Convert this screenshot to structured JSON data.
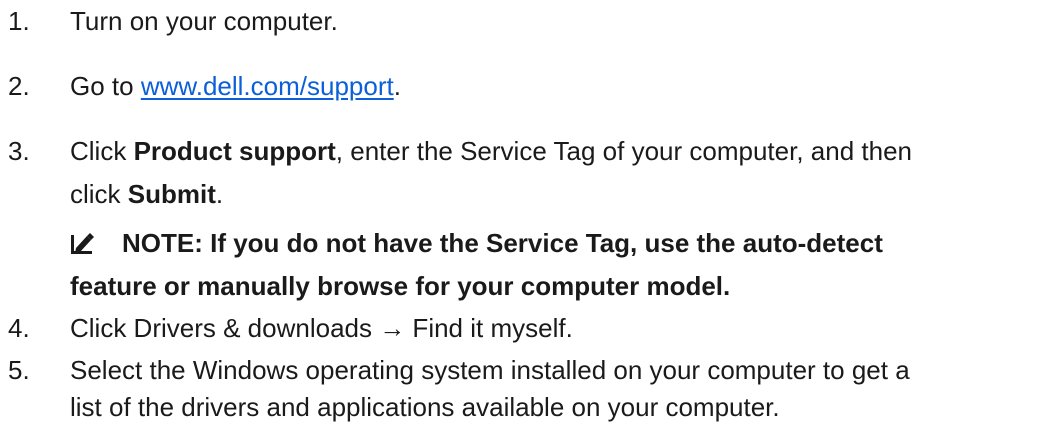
{
  "steps": [
    {
      "num": "1.",
      "text": "Turn on your computer."
    },
    {
      "num": "2.",
      "pre": "Go to ",
      "link": "www.dell.com/support",
      "post": "."
    },
    {
      "num": "3.",
      "pre": "Click ",
      "bold1": "Product support",
      "mid": ", enter the Service Tag of your computer, and then",
      "cont_pre": "click ",
      "bold2": "Submit",
      "cont_post": "."
    },
    {
      "num": "4.",
      "text": "Click Drivers & downloads → Find it myself."
    },
    {
      "num": "5.",
      "text": "Select the Windows operating system installed on your computer to get a",
      "cont": "list of the drivers and applications available on your computer."
    }
  ],
  "note": {
    "icon": "pencil-note-icon",
    "line1": "NOTE: If you do not have the Service Tag, use the auto-detect",
    "line2": "feature or manually browse for your computer model."
  }
}
